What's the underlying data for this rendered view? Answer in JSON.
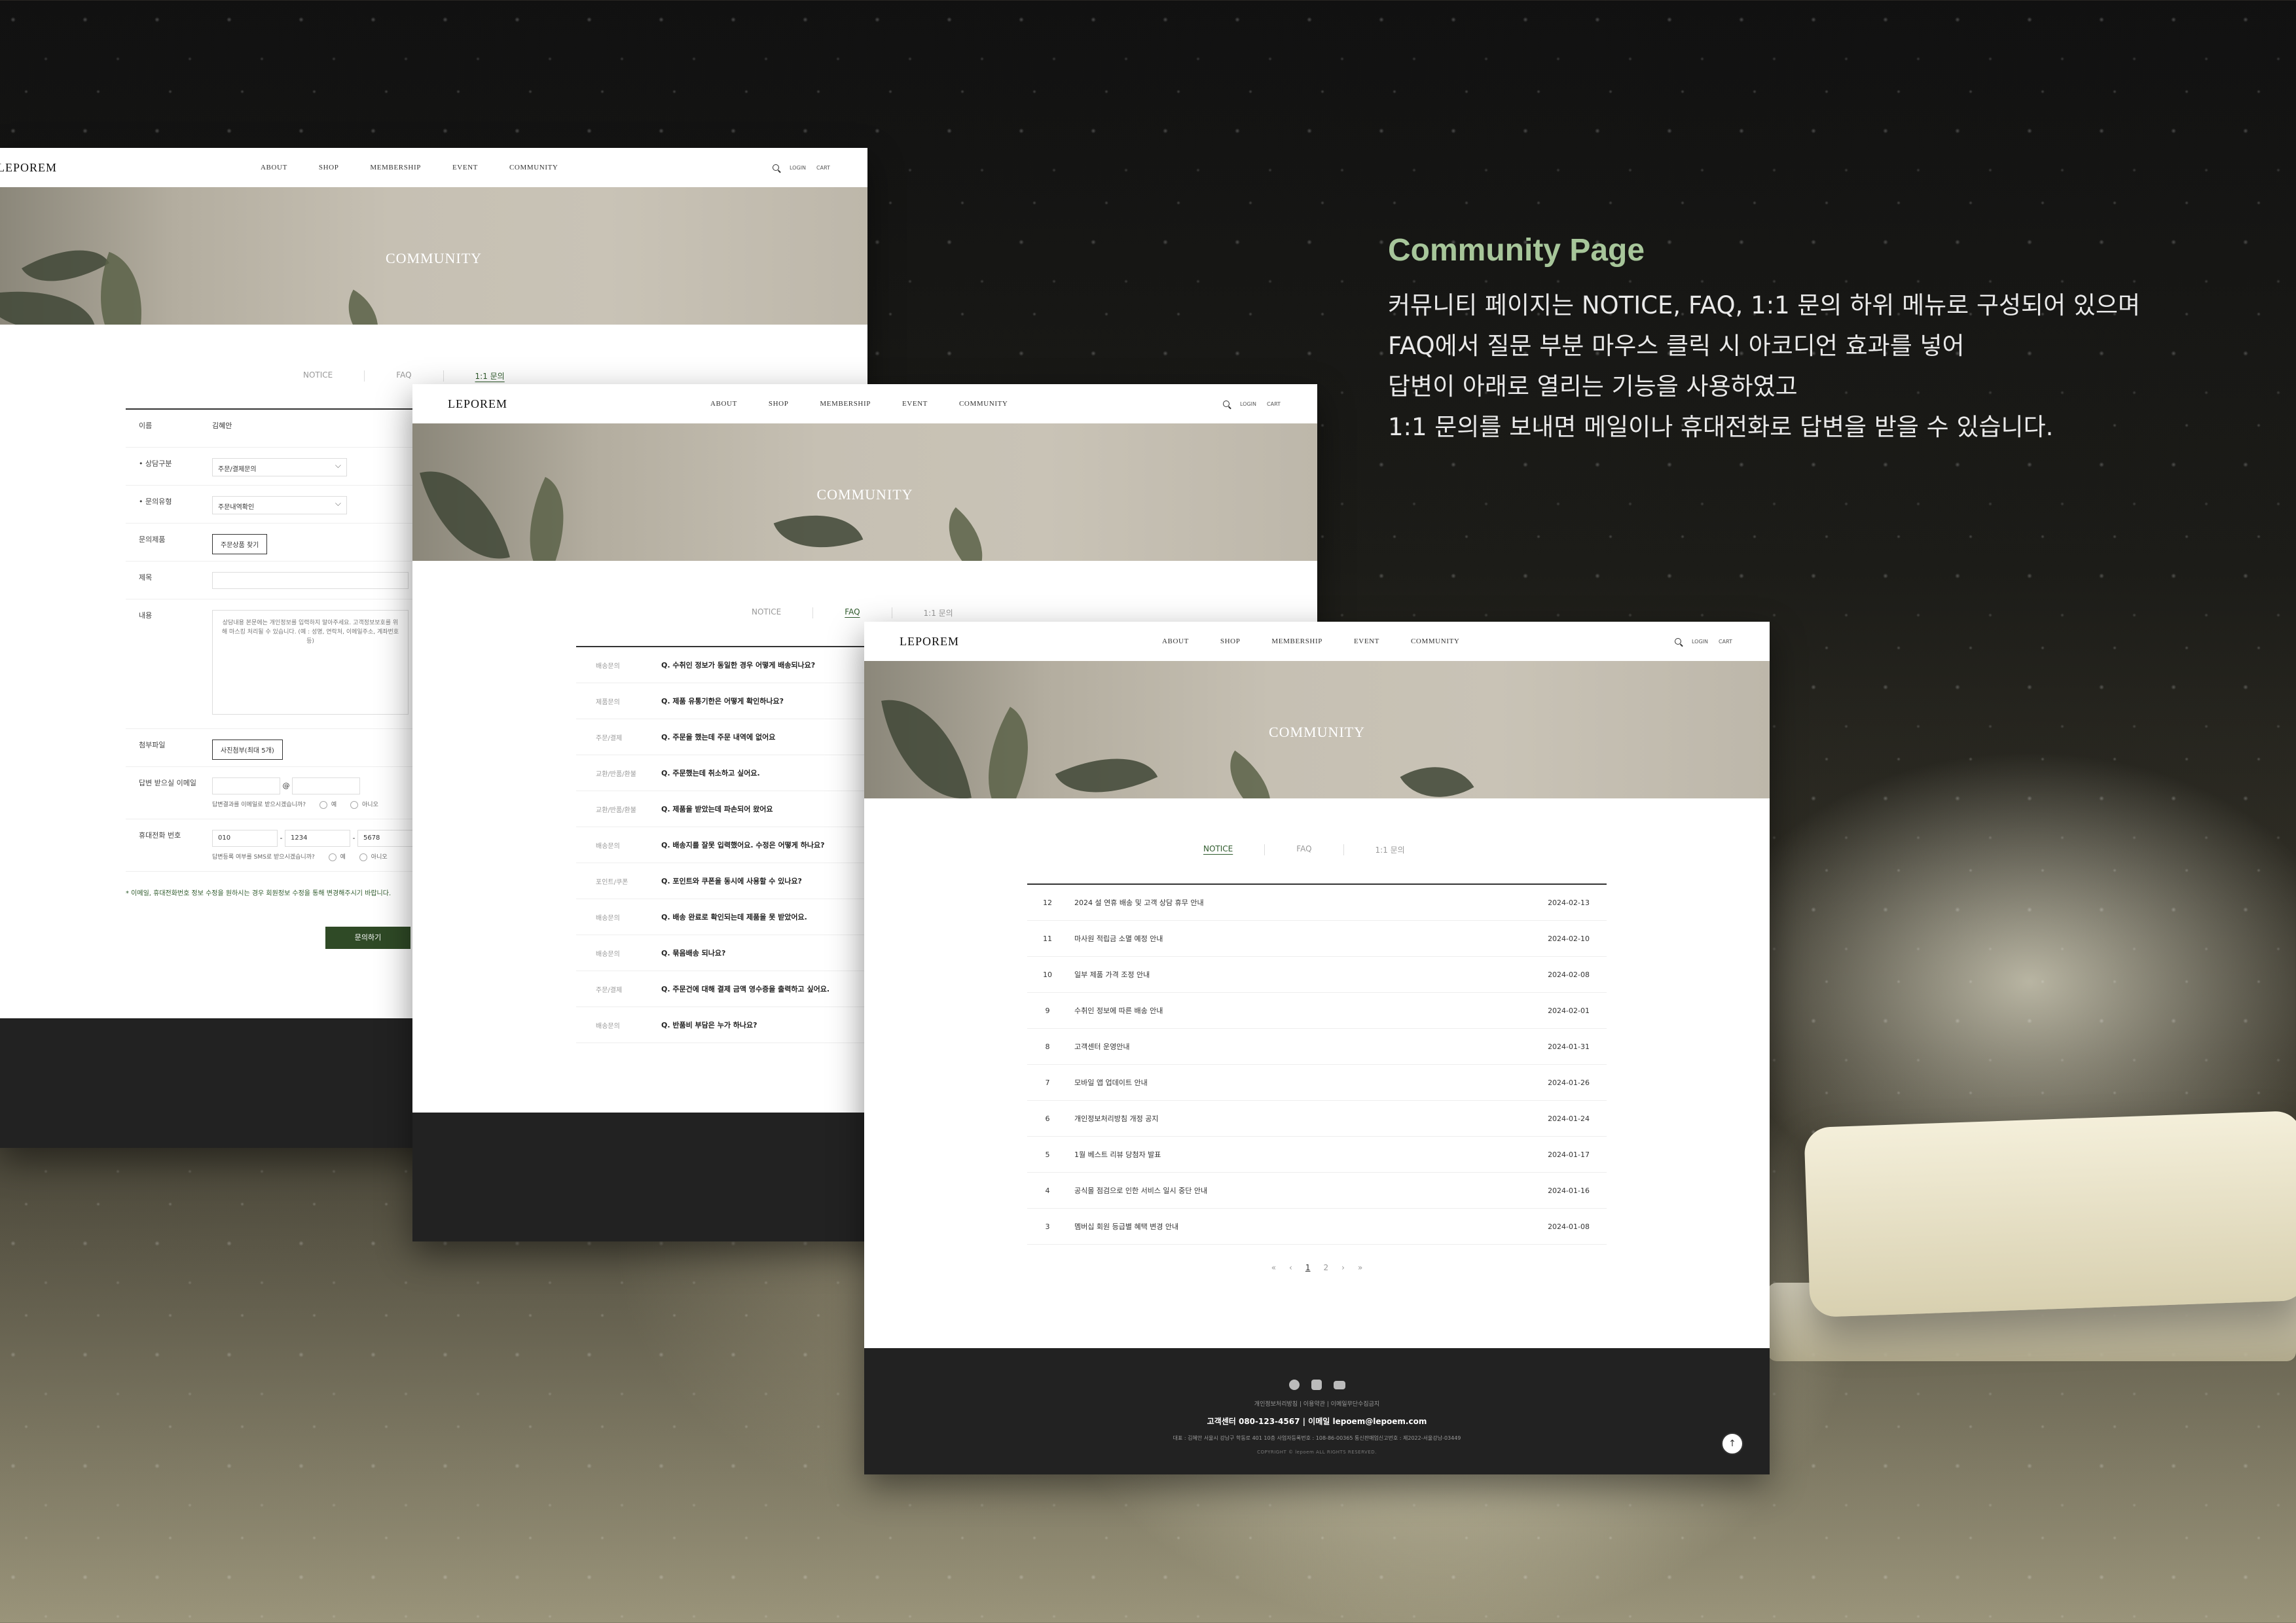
{
  "description": {
    "title": "Community Page",
    "lines": [
      "커뮤니티 페이지는 NOTICE, FAQ, 1:1 문의 하위 메뉴로 구성되어 있으며",
      "FAQ에서 질문 부분 마우스 클릭 시 아코디언 효과를 넣어",
      "답변이 아래로 열리는 기능을 사용하였고",
      "1:1 문의를 보내면 메일이나 휴대전화로 답변을 받을 수 있습니다."
    ]
  },
  "gnb": {
    "logo": "LEPOREM",
    "menu": [
      "ABOUT",
      "SHOP",
      "MEMBERSHIP",
      "EVENT",
      "COMMUNITY"
    ],
    "login": "LOGIN",
    "cart": "CART"
  },
  "hero_title": "COMMUNITY",
  "tabs": [
    "NOTICE",
    "FAQ",
    "1:1 문의"
  ],
  "inquiry": {
    "name_label": "이름",
    "name_value": "김혜안",
    "consult_label": "• 상담구분",
    "consult_value": "주문/결제문의",
    "type_label": "• 문의유형",
    "type_value": "주문내역확인",
    "product_label": "문의제품",
    "product_button": "주문상품 찾기",
    "subject_label": "제목",
    "content_label": "내용",
    "content_placeholder": "상담내용 본문에는 개인정보를 입력하지 말아주세요. 고객정보보호를 위해 마스킹 처리될 수 있습니다. (예 : 성명, 연락처, 이메일주소, 계좌번호 등)",
    "attach_label": "첨부파일",
    "attach_button": "사진첨부(최대 5개)",
    "email_label": "답변 받으실 이메일",
    "email_at": "@",
    "email_question": "답변결과를 이메일로 받으시겠습니까?",
    "yes": "예",
    "no": "아니오",
    "phone_label": "휴대전화 번호",
    "phone": [
      "010",
      "1234",
      "5678"
    ],
    "phone_dash": "-",
    "sms_question": "답변등록 여부를 SMS로 받으시겠습니까?",
    "notice": "* 이메일, 휴대전화번호 정보 수정을 원하시는 경우 회원정보 수정을 통해 변경해주시기 바랍니다.",
    "submit": "문의하기"
  },
  "faq": [
    {
      "cat": "배송문의",
      "q": "Q. 수취인 정보가 동일한 경우 어떻게 배송되나요?"
    },
    {
      "cat": "제품문의",
      "q": "Q. 제품 유통기한은 어떻게 확인하나요?"
    },
    {
      "cat": "주문/결제",
      "q": "Q. 주문을 했는데 주문 내역에 없어요"
    },
    {
      "cat": "교환/반품/환불",
      "q": "Q. 주문했는데 취소하고 싶어요."
    },
    {
      "cat": "교환/반품/환불",
      "q": "Q. 제품을 받았는데 파손되어 왔어요"
    },
    {
      "cat": "배송문의",
      "q": "Q. 배송지를 잘못 입력했어요. 수정은 어떻게 하나요?"
    },
    {
      "cat": "포인트/쿠폰",
      "q": "Q. 포인트와 쿠폰을 동시에 사용할 수 있나요?"
    },
    {
      "cat": "배송문의",
      "q": "Q. 배송 완료로 확인되는데 제품을 못 받았어요."
    },
    {
      "cat": "배송문의",
      "q": "Q. 묶음배송 되나요?"
    },
    {
      "cat": "주문/결제",
      "q": "Q. 주문건에 대해 결제 금액 영수증을 출력하고 싶어요."
    },
    {
      "cat": "배송문의",
      "q": "Q. 반품비 부담은 누가 하나요?"
    }
  ],
  "notices": [
    {
      "num": "12",
      "title": "2024 설 연휴 배송 및 고객 상담 휴무 안내",
      "date": "2024-02-13"
    },
    {
      "num": "11",
      "title": "마사원 적립금 소멸 예정 안내",
      "date": "2024-02-10"
    },
    {
      "num": "10",
      "title": "일부 제품 가격 조정 안내",
      "date": "2024-02-08"
    },
    {
      "num": "9",
      "title": "수취인 정보에 따른 배송 안내",
      "date": "2024-02-01"
    },
    {
      "num": "8",
      "title": "고객센터 운영안내",
      "date": "2024-01-31"
    },
    {
      "num": "7",
      "title": "모바일 앱 업데이트 안내",
      "date": "2024-01-26"
    },
    {
      "num": "6",
      "title": "개인정보처리방침 개정 공지",
      "date": "2024-01-24"
    },
    {
      "num": "5",
      "title": "1월 베스트 리뷰 당첨자 발표",
      "date": "2024-01-17"
    },
    {
      "num": "4",
      "title": "공식몰 점검으로 인한 서비스 일시 중단 안내",
      "date": "2024-01-16"
    },
    {
      "num": "3",
      "title": "멤버십 회원 등급별 혜택 변경 안내",
      "date": "2024-01-08"
    }
  ],
  "pager": {
    "first": "«",
    "prev": "‹",
    "pages": [
      "1",
      "2"
    ],
    "next": "›",
    "last": "»"
  },
  "footer": {
    "links": "개인정보처리방침  |  이용약관  |  이메일무단수집금지",
    "cs": "고객센터  080-123-4567  |  이메일  lepoem@lepoem.com",
    "address": "대표 : 김혜안  서울시 강남구 학동로 401 10층  사업자등록번호 : 108-86-00365 통신판매업신고번호 : 제2022-서울강남-03449",
    "copyright": "COPYRIGHT © lepoem ALL RIGHTS RESERVED."
  },
  "icons": {
    "search": "search-icon",
    "facebook": "facebook-icon",
    "instagram": "instagram-icon",
    "youtube": "youtube-icon",
    "top": "arrow-up-icon"
  },
  "colors": {
    "accent": "#2e5a2b",
    "title": "#a7c69a",
    "footer": "#222222"
  }
}
